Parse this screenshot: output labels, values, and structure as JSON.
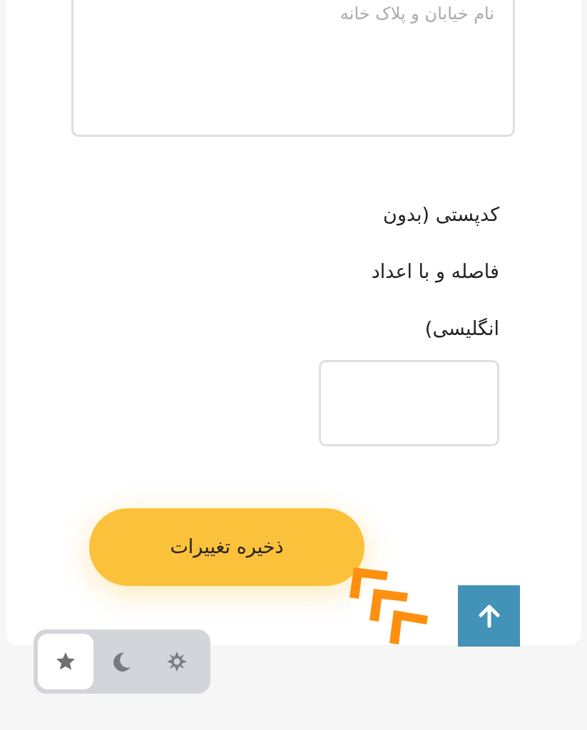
{
  "address": {
    "placeholder": "نام خیابان و پلاک خانه"
  },
  "postal_code": {
    "label": "کدپستی (بدون فاصله و با اعداد انگلیسی)"
  },
  "save_button": {
    "label": "ذخیره تغییرات"
  },
  "theme_switcher": {
    "options": [
      {
        "kind": "star",
        "selected": true
      },
      {
        "kind": "moon",
        "selected": false
      },
      {
        "kind": "sun",
        "selected": false
      }
    ]
  }
}
